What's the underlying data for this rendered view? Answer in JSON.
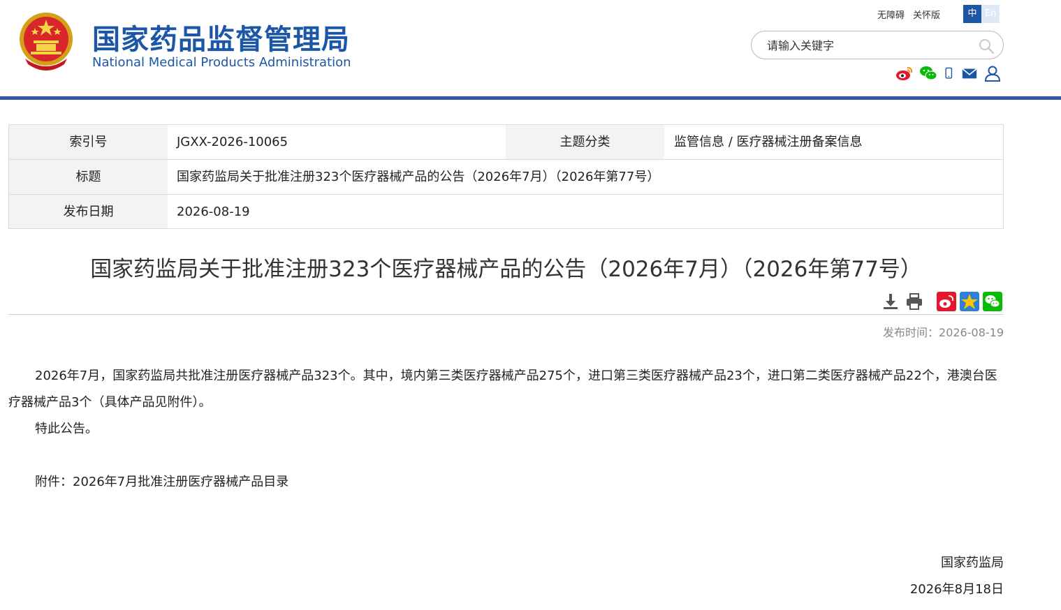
{
  "header": {
    "logo_cn": "国家药品监督管理局",
    "logo_en": "National Medical Products Administration",
    "top_links": [
      "无障碍",
      "关怀版"
    ],
    "lang_zh": "中",
    "lang_en": "En",
    "search_placeholder": "请输入关键字",
    "social_icons": [
      "weibo-icon",
      "wechat-icon",
      "mobile-icon",
      "mail-icon",
      "user-icon"
    ]
  },
  "info": {
    "index_label": "索引号",
    "index_value": "JGXX-2026-10065",
    "topic_label": "主题分类",
    "topic_value": "监管信息 / 医疗器械注册备案信息",
    "title_label": "标题",
    "title_value": "国家药监局关于批准注册323个医疗器械产品的公告（2026年7月）（2026年第77号）",
    "date_label": "发布日期",
    "date_value": "2026-08-19"
  },
  "article": {
    "title": "国家药监局关于批准注册323个医疗器械产品的公告（2026年7月）（2026年第77号）",
    "pubtime_label": "发布时间：",
    "pubtime_value": "2026-08-19",
    "paragraph1": "2026年7月，国家药监局共批准注册医疗器械产品323个。其中，境内第三类医疗器械产品275个，进口第三类医疗器械产品23个，进口第二类医疗器械产品22个，港澳台医疗器械产品3个（具体产品见附件）。",
    "paragraph2": "特此公告。",
    "attachment": "附件：2026年7月批准注册医疗器械产品目录",
    "sign_org": "国家药监局",
    "sign_date": "2026年8月18日"
  },
  "colors": {
    "brand_blue": "#1b57a6",
    "header_line": "#2d5aa0",
    "weibo_red": "#e6162d",
    "wechat_green": "#09bb07"
  }
}
